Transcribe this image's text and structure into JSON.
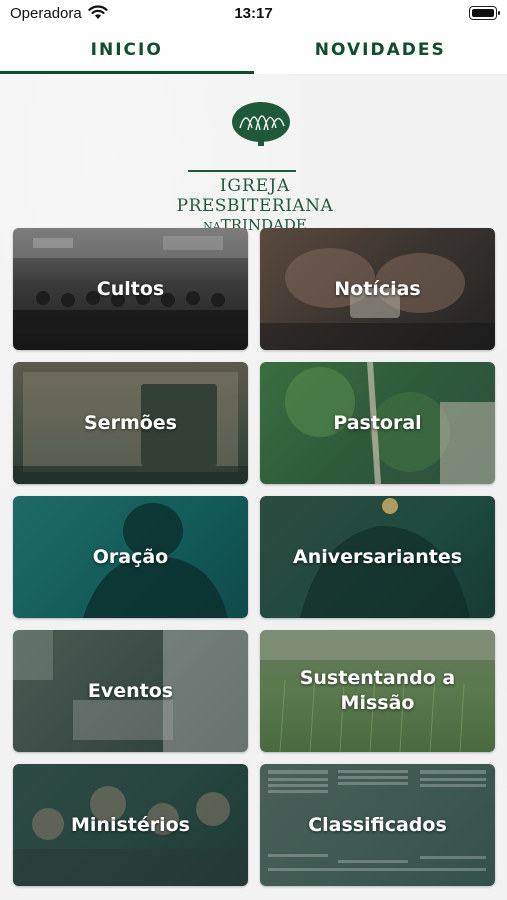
{
  "status_bar": {
    "carrier": "Operadora",
    "time": "13:17"
  },
  "tabs": [
    {
      "label": "INICIO",
      "active": true
    },
    {
      "label": "NOVIDADES",
      "active": false
    }
  ],
  "logo": {
    "line1": "IGREJA",
    "line2": "PRESBITERIANA",
    "line3_small": "NA",
    "line3": "TRINDADE"
  },
  "menu": [
    {
      "label": "Cultos"
    },
    {
      "label": "Notícias"
    },
    {
      "label": "Sermões"
    },
    {
      "label": "Pastoral"
    },
    {
      "label": "Oração"
    },
    {
      "label": "Aniversariantes"
    },
    {
      "label": "Eventos"
    },
    {
      "label": "Sustentando a Missão"
    },
    {
      "label": "Ministérios"
    },
    {
      "label": "Classificados"
    }
  ],
  "colors": {
    "brand_green": "#0f4d2e",
    "logo_green": "#1e5a3a"
  }
}
